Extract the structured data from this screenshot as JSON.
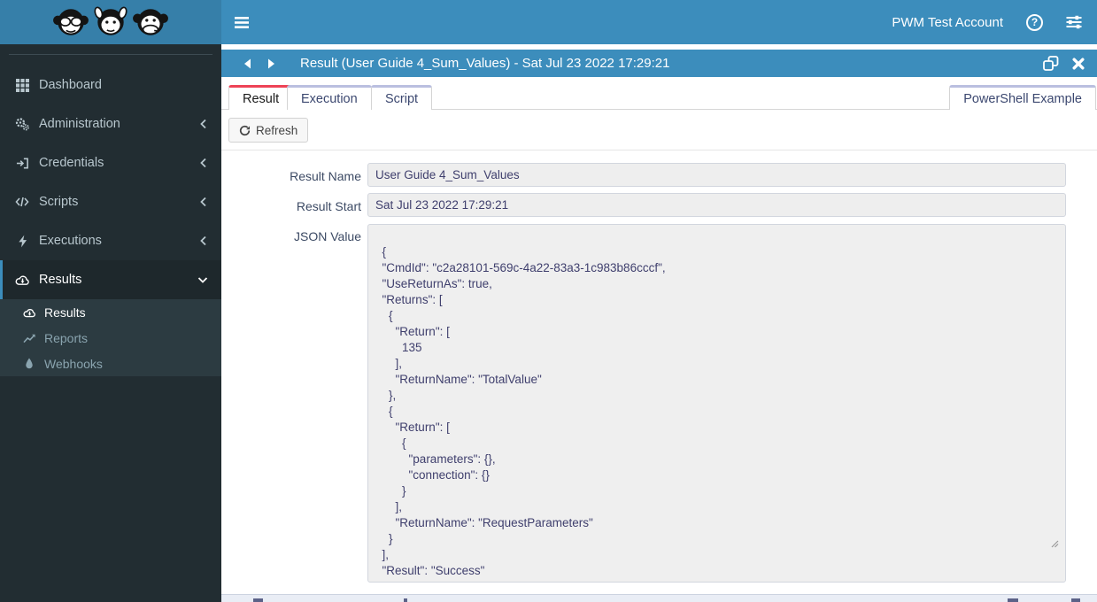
{
  "colors": {
    "navbar": "#3c8dbc",
    "logo_bg": "#367fa9",
    "sidebar_bg": "#222d32",
    "submenu_bg": "#2c3b41",
    "titlebar": "#3c8dbc",
    "active_tab_accent": "#ee4256",
    "inactive_tab_accent": "#babfe0"
  },
  "navbar": {
    "account": "PWM Test Account",
    "help_glyph": "?"
  },
  "sidebar": {
    "items": [
      {
        "label": "Dashboard",
        "icon": "grid-icon"
      },
      {
        "label": "Administration",
        "icon": "gears-icon"
      },
      {
        "label": "Credentials",
        "icon": "sign-in-icon"
      },
      {
        "label": "Scripts",
        "icon": "code-icon"
      },
      {
        "label": "Executions",
        "icon": "bolt-icon"
      },
      {
        "label": "Results",
        "icon": "cloud-download-icon"
      }
    ],
    "submenu": [
      {
        "label": "Results",
        "icon": "cloud-download-icon"
      },
      {
        "label": "Reports",
        "icon": "chart-line-icon"
      },
      {
        "label": "Webhooks",
        "icon": "droplet-icon"
      }
    ]
  },
  "window": {
    "title": "Result (User Guide 4_Sum_Values) - Sat Jul 23 2022 17:29:21"
  },
  "tabs": {
    "items": [
      {
        "label": "Result"
      },
      {
        "label": "Execution"
      },
      {
        "label": "Script"
      }
    ],
    "right_tab": "PowerShell Example"
  },
  "toolbar": {
    "refresh_label": "Refresh"
  },
  "form": {
    "result_name": {
      "label": "Result Name",
      "value": "User Guide 4_Sum_Values"
    },
    "result_start": {
      "label": "Result Start",
      "value": "Sat Jul 23 2022 17:29:21"
    },
    "json_value": {
      "label": "JSON Value",
      "value": "{\n  \"CmdId\": \"c2a28101-569c-4a22-83a3-1c983b86cccf\",\n  \"UseReturnAs\": true,\n  \"Returns\": [\n    {\n      \"Return\": [\n        135\n      ],\n      \"ReturnName\": \"TotalValue\"\n    },\n    {\n      \"Return\": [\n        {\n          \"parameters\": {},\n          \"connection\": {}\n        }\n      ],\n      \"ReturnName\": \"RequestParameters\"\n    }\n  ],\n  \"Result\": \"Success\"\n}"
    }
  }
}
